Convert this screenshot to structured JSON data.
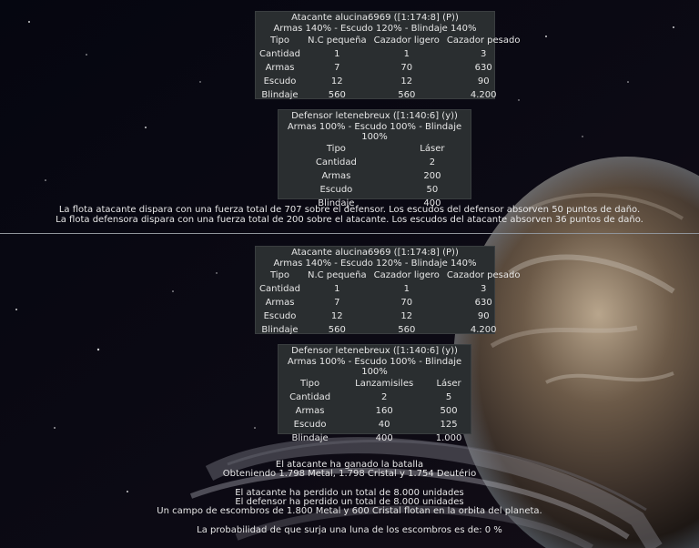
{
  "round1": {
    "attacker": {
      "title": "Atacante alucina6969 ([1:174:8] (P))",
      "tech": "Armas 140% - Escudo 120% - Blindaje 140%",
      "rows": [
        [
          "Tipo",
          "N.C pequeña",
          "Cazador ligero",
          "Cazador pesado"
        ],
        [
          "Cantidad",
          "1",
          "1",
          "3"
        ],
        [
          "Armas",
          "7",
          "70",
          "630"
        ],
        [
          "Escudo",
          "12",
          "12",
          "90"
        ],
        [
          "Blindaje",
          "560",
          "560",
          "4.200"
        ]
      ]
    },
    "defender": {
      "title": "Defensor letenebreux ([1:140:6] (y))",
      "tech": "Armas 100% - Escudo 100% - Blindaje 100%",
      "rows": [
        [
          "Tipo",
          "Láser"
        ],
        [
          "Cantidad",
          "2"
        ],
        [
          "Armas",
          "200"
        ],
        [
          "Escudo",
          "50"
        ],
        [
          "Blindaje",
          "400"
        ]
      ]
    },
    "attack_message": "La flota atacante dispara con una fuerza total de 707 sobre el defensor. Los escudos del defensor absorven 50 puntos de daño.",
    "defense_message": "La flota defensora dispara con una fuerza total de 200 sobre el atacante. Los escudos del atacante absorven 36 puntos de daño."
  },
  "round2": {
    "attacker": {
      "title": "Atacante alucina6969 ([1:174:8] (P))",
      "tech": "Armas 140% - Escudo 120% - Blindaje 140%",
      "rows": [
        [
          "Tipo",
          "N.C pequeña",
          "Cazador ligero",
          "Cazador pesado"
        ],
        [
          "Cantidad",
          "1",
          "1",
          "3"
        ],
        [
          "Armas",
          "7",
          "70",
          "630"
        ],
        [
          "Escudo",
          "12",
          "12",
          "90"
        ],
        [
          "Blindaje",
          "560",
          "560",
          "4.200"
        ]
      ]
    },
    "defender": {
      "title": "Defensor letenebreux ([1:140:6] (y))",
      "tech": "Armas 100% - Escudo 100% - Blindaje 100%",
      "rows": [
        [
          "Tipo",
          "Lanzamisiles",
          "Láser"
        ],
        [
          "Cantidad",
          "2",
          "5"
        ],
        [
          "Armas",
          "160",
          "500"
        ],
        [
          "Escudo",
          "40",
          "125"
        ],
        [
          "Blindaje",
          "400",
          "1.000"
        ]
      ]
    }
  },
  "result": {
    "winner": "El atacante ha ganado la batalla",
    "loot": "Obteniendo 1.798 Metal, 1.798 Cristal y 1.754 Deutério",
    "attacker_losses": "El atacante ha perdido un total de 8.000 unidades",
    "defender_losses": "El defensor ha perdido un total de 8.000 unidades",
    "debris": "Un campo de escombros de 1.800 Metal y 600 Cristal flotan en la orbita del planeta.",
    "moon_chance": "La probabilidad de que surja una luna de los escombros es de: 0 %"
  },
  "colors": {
    "panel": "#2a2e30",
    "text": "#e6e6e6",
    "divider": "#8f949a"
  }
}
